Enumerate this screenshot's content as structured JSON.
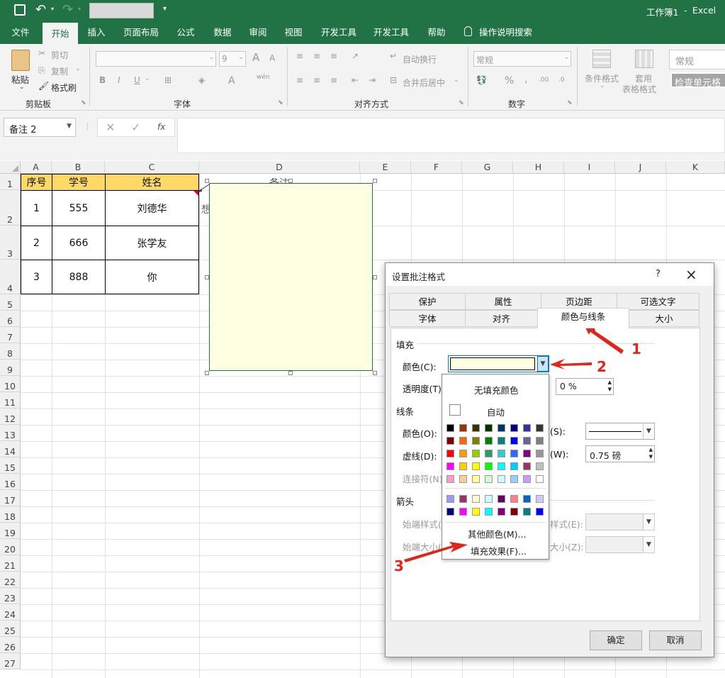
{
  "app": {
    "doc_title": "工作簿1",
    "sep": "-",
    "app_name": "Excel"
  },
  "qat": {
    "save": "save-icon",
    "undo": "undo-icon",
    "redo": "redo-icon"
  },
  "tabs": [
    "文件",
    "开始",
    "插入",
    "页面布局",
    "公式",
    "数据",
    "审阅",
    "视图",
    "开发工具",
    "开发工具",
    "帮助",
    "操作说明搜索"
  ],
  "ribbon": {
    "clipboard": {
      "paste": "粘贴",
      "cut": "剪切",
      "copy": "复制",
      "format_painter": "格式刷",
      "label": "剪贴板"
    },
    "font": {
      "size": "9",
      "bold": "B",
      "italic": "I",
      "underline": "U",
      "label": "字体",
      "grow": "A",
      "shrink": "A",
      "wen": "wén"
    },
    "align": {
      "wrap": "自动换行",
      "merge": "合并后居中",
      "label": "对齐方式"
    },
    "number": {
      "format": "常规",
      "percent": "%",
      "comma": ",",
      "label": "数字"
    },
    "styles": {
      "cond": "条件格式",
      "table1": "套用",
      "table2": "表格格式",
      "style1": "常规",
      "style2": "检查单元格"
    }
  },
  "formula_bar": {
    "name_box": "备注 2",
    "fx": "fx"
  },
  "columns": [
    "A",
    "B",
    "C",
    "D",
    "E",
    "F",
    "G",
    "H",
    "I",
    "J",
    "K"
  ],
  "rows": [
    "1",
    "2",
    "3",
    "4",
    "5",
    "6",
    "7",
    "8",
    "9",
    "10",
    "11",
    "12",
    "13",
    "14",
    "15",
    "16",
    "17",
    "18",
    "19",
    "20",
    "21",
    "22",
    "23",
    "24",
    "25",
    "26",
    "27"
  ],
  "table": {
    "headers": [
      "序号",
      "学号",
      "姓名"
    ],
    "rows": [
      [
        "1",
        "555",
        "刘德华"
      ],
      [
        "2",
        "666",
        "张学友"
      ],
      [
        "3",
        "888",
        "你"
      ]
    ]
  },
  "comment": {
    "d1_text": "备注",
    "partial_text": "想"
  },
  "dialog": {
    "title": "设置批注格式",
    "help": "?",
    "close": "×",
    "tabs_row1": [
      "保护",
      "属性",
      "页边距",
      "可选文字"
    ],
    "tabs_row2": [
      "字体",
      "对齐",
      "颜色与线条",
      "大小"
    ],
    "fill_section": "填充",
    "color_label": "颜色(C):",
    "transparency_label": "透明度(T):",
    "transparency_value": "0 %",
    "line_section": "线条",
    "line_color_label": "颜色(O):",
    "dash_label": "虚线(D):",
    "connector_label": "连接符(N)",
    "style_label": "(S):",
    "weight_label": "(W):",
    "weight_value": "0.75 磅",
    "arrows_section": "箭头",
    "begin_style": "始端样式(B",
    "begin_size": "始端大小(I",
    "end_style": "样式(E):",
    "end_size": "大小(Z):",
    "ok": "确定",
    "cancel": "取消"
  },
  "palette": {
    "no_fill": "无填充颜色",
    "auto": "自动",
    "more_colors": "其他颜色(M)...",
    "fill_effects": "填充效果(F)...",
    "grid": [
      [
        "#000000",
        "#993300",
        "#333300",
        "#003300",
        "#003366",
        "#000080",
        "#333399",
        "#333333"
      ],
      [
        "#800000",
        "#ff6600",
        "#808000",
        "#008000",
        "#008080",
        "#0000ff",
        "#666699",
        "#808080"
      ],
      [
        "#ff0000",
        "#ff9900",
        "#99cc00",
        "#339966",
        "#33cccc",
        "#3366ff",
        "#800080",
        "#969696"
      ],
      [
        "#ff00ff",
        "#ffcc00",
        "#ffff00",
        "#00ff00",
        "#00ffff",
        "#00ccff",
        "#993366",
        "#c0c0c0"
      ],
      [
        "#ff99cc",
        "#ffcc99",
        "#ffff99",
        "#ccffcc",
        "#ccffff",
        "#99ccff",
        "#cc99ff",
        "#ffffff"
      ]
    ],
    "grid2": [
      [
        "#9999ff",
        "#993366",
        "#ffffcc",
        "#ccffff",
        "#660066",
        "#ff8080",
        "#0066cc",
        "#ccccff"
      ],
      [
        "#000080",
        "#ff00ff",
        "#ffff00",
        "#00ffff",
        "#800080",
        "#800000",
        "#008080",
        "#0000ff"
      ]
    ]
  },
  "annotations": {
    "a1": "1",
    "a2": "2",
    "a3": "3"
  },
  "colors": {
    "excel_green": "#217346",
    "header_fill": "#ffd966",
    "comment_fill": "#ffffe1",
    "annot_red": "#e1251b"
  }
}
